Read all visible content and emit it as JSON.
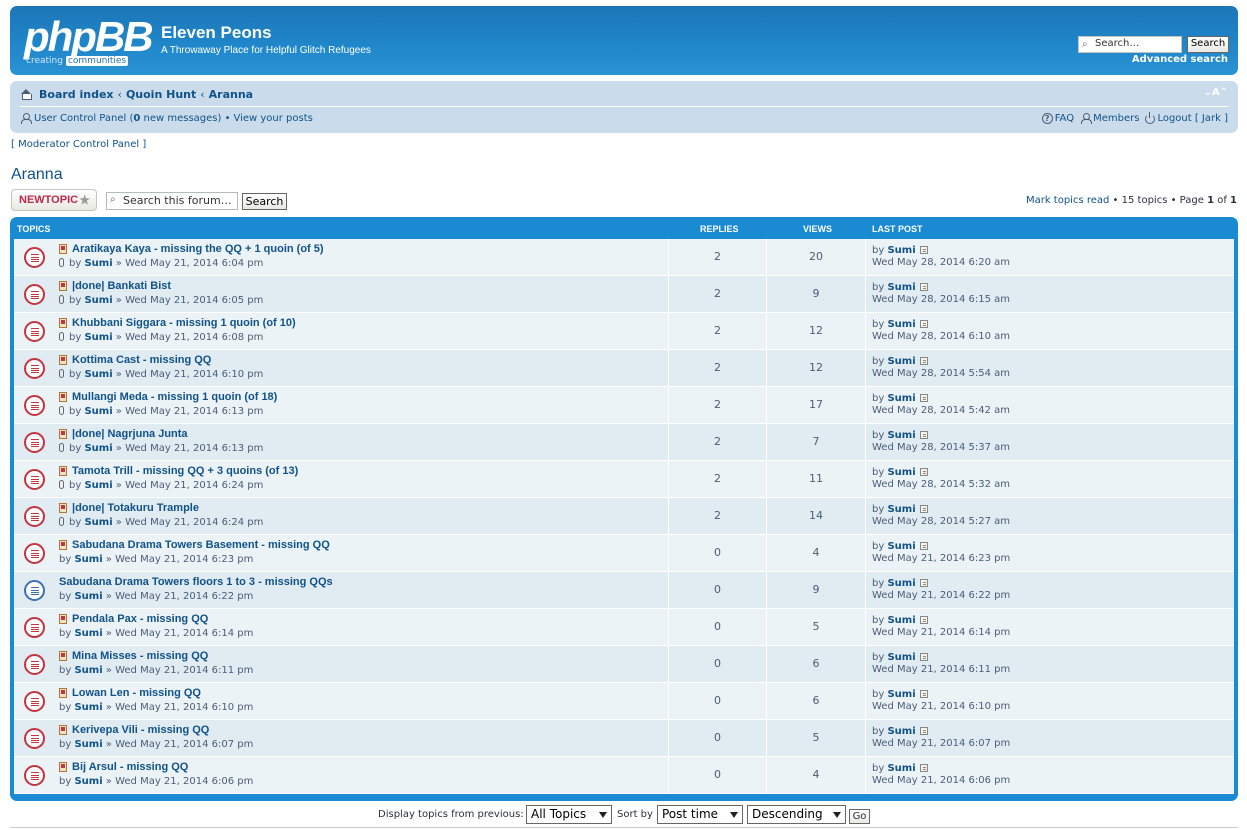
{
  "header": {
    "logo_main": "phpBB",
    "logo_tag1": "creating",
    "logo_tag2": "communities",
    "site_title": "Eleven Peons",
    "site_desc": "A Throwaway Place for Helpful Glitch Refugees",
    "search_placeholder": "Search…",
    "search_button": "Search",
    "advanced_search": "Advanced search"
  },
  "nav": {
    "breadcrumb": [
      "Board index",
      "Quoin Hunt",
      "Aranna"
    ],
    "separator": "‹",
    "fontsize": "⌄A⌃",
    "ucp_label": "User Control Panel (",
    "ucp_count": "0",
    "ucp_suffix": " new messages) • ",
    "view_posts": "View your posts",
    "faq": "FAQ",
    "members": "Members",
    "logout": "Logout [ Jark ]"
  },
  "moderator_panel": "[ Moderator Control Panel ]",
  "forum_title": "Aranna",
  "actions": {
    "new_topic": "NEWTOPIC",
    "new_topic_star": "★",
    "search_placeholder": "Search this forum…",
    "search_button": "Search",
    "mark_read": "Mark topics read",
    "topics_count": " • 15 topics • Page ",
    "page_current": "1",
    "page_of": " of ",
    "page_total": "1"
  },
  "table": {
    "headers": {
      "topics": "Topics",
      "replies": "Replies",
      "views": "Views",
      "last_post": "Last post"
    },
    "rows": [
      {
        "title": "Aratikaya Kaya - missing the QQ + 1 quoin (of 5)",
        "by": "by ",
        "author": "Sumi",
        "posted": " » Wed May 21, 2014 6:04 pm",
        "replies": "2",
        "views": "20",
        "lp_by": "by ",
        "lp_author": "Sumi",
        "lp_date": "Wed May 28, 2014 6:20 am",
        "icon": true,
        "attach": true,
        "read": false
      },
      {
        "title": "|done| Bankati Bist",
        "by": "by ",
        "author": "Sumi",
        "posted": " » Wed May 21, 2014 6:05 pm",
        "replies": "2",
        "views": "9",
        "lp_by": "by ",
        "lp_author": "Sumi",
        "lp_date": "Wed May 28, 2014 6:15 am",
        "icon": true,
        "attach": true,
        "read": false
      },
      {
        "title": "Khubbani Siggara - missing 1 quoin (of 10)",
        "by": "by ",
        "author": "Sumi",
        "posted": " » Wed May 21, 2014 6:08 pm",
        "replies": "2",
        "views": "12",
        "lp_by": "by ",
        "lp_author": "Sumi",
        "lp_date": "Wed May 28, 2014 6:10 am",
        "icon": true,
        "attach": true,
        "read": false
      },
      {
        "title": "Kottima Cast - missing QQ",
        "by": "by ",
        "author": "Sumi",
        "posted": " » Wed May 21, 2014 6:10 pm",
        "replies": "2",
        "views": "12",
        "lp_by": "by ",
        "lp_author": "Sumi",
        "lp_date": "Wed May 28, 2014 5:54 am",
        "icon": true,
        "attach": true,
        "read": false
      },
      {
        "title": "Mullangi Meda - missing 1 quoin (of 18)",
        "by": "by ",
        "author": "Sumi",
        "posted": " » Wed May 21, 2014 6:13 pm",
        "replies": "2",
        "views": "17",
        "lp_by": "by ",
        "lp_author": "Sumi",
        "lp_date": "Wed May 28, 2014 5:42 am",
        "icon": true,
        "attach": true,
        "read": false
      },
      {
        "title": "|done| Nagrjuna Junta",
        "by": "by ",
        "author": "Sumi",
        "posted": " » Wed May 21, 2014 6:13 pm",
        "replies": "2",
        "views": "7",
        "lp_by": "by ",
        "lp_author": "Sumi",
        "lp_date": "Wed May 28, 2014 5:37 am",
        "icon": true,
        "attach": true,
        "read": false
      },
      {
        "title": "Tamota Trill - missing QQ + 3 quoins (of 13)",
        "by": "by ",
        "author": "Sumi",
        "posted": " » Wed May 21, 2014 6:24 pm",
        "replies": "2",
        "views": "11",
        "lp_by": "by ",
        "lp_author": "Sumi",
        "lp_date": "Wed May 28, 2014 5:32 am",
        "icon": true,
        "attach": true,
        "read": false
      },
      {
        "title": "|done| Totakuru Trample",
        "by": "by ",
        "author": "Sumi",
        "posted": " » Wed May 21, 2014 6:24 pm",
        "replies": "2",
        "views": "14",
        "lp_by": "by ",
        "lp_author": "Sumi",
        "lp_date": "Wed May 28, 2014 5:27 am",
        "icon": true,
        "attach": true,
        "read": false
      },
      {
        "title": "Sabudana Drama Towers Basement - missing QQ",
        "by": "by ",
        "author": "Sumi",
        "posted": " » Wed May 21, 2014 6:23 pm",
        "replies": "0",
        "views": "4",
        "lp_by": "by ",
        "lp_author": "Sumi",
        "lp_date": "Wed May 21, 2014 6:23 pm",
        "icon": true,
        "attach": false,
        "read": false
      },
      {
        "title": "Sabudana Drama Towers floors 1 to 3 - missing QQs",
        "by": "by ",
        "author": "Sumi",
        "posted": " » Wed May 21, 2014 6:22 pm",
        "replies": "0",
        "views": "9",
        "lp_by": "by ",
        "lp_author": "Sumi",
        "lp_date": "Wed May 21, 2014 6:22 pm",
        "icon": false,
        "attach": false,
        "read": true
      },
      {
        "title": "Pendala Pax - missing QQ",
        "by": "by ",
        "author": "Sumi",
        "posted": " » Wed May 21, 2014 6:14 pm",
        "replies": "0",
        "views": "5",
        "lp_by": "by ",
        "lp_author": "Sumi",
        "lp_date": "Wed May 21, 2014 6:14 pm",
        "icon": true,
        "attach": false,
        "read": false
      },
      {
        "title": "Mina Misses - missing QQ",
        "by": "by ",
        "author": "Sumi",
        "posted": " » Wed May 21, 2014 6:11 pm",
        "replies": "0",
        "views": "6",
        "lp_by": "by ",
        "lp_author": "Sumi",
        "lp_date": "Wed May 21, 2014 6:11 pm",
        "icon": true,
        "attach": false,
        "read": false
      },
      {
        "title": "Lowan Len - missing QQ",
        "by": "by ",
        "author": "Sumi",
        "posted": " » Wed May 21, 2014 6:10 pm",
        "replies": "0",
        "views": "6",
        "lp_by": "by ",
        "lp_author": "Sumi",
        "lp_date": "Wed May 21, 2014 6:10 pm",
        "icon": true,
        "attach": false,
        "read": false
      },
      {
        "title": "Kerivepa Vili - missing QQ",
        "by": "by ",
        "author": "Sumi",
        "posted": " » Wed May 21, 2014 6:07 pm",
        "replies": "0",
        "views": "5",
        "lp_by": "by ",
        "lp_author": "Sumi",
        "lp_date": "Wed May 21, 2014 6:07 pm",
        "icon": true,
        "attach": false,
        "read": false
      },
      {
        "title": "Bij Arsul - missing QQ",
        "by": "by ",
        "author": "Sumi",
        "posted": " » Wed May 21, 2014 6:06 pm",
        "replies": "0",
        "views": "4",
        "lp_by": "by ",
        "lp_author": "Sumi",
        "lp_date": "Wed May 21, 2014 6:06 pm",
        "icon": true,
        "attach": false,
        "read": false
      }
    ]
  },
  "bottom": {
    "display_label": "Display topics from previous:",
    "display_value": "All Topics",
    "sort_label": "Sort by",
    "sort_value": "Post time",
    "order_value": "Descending",
    "go": "Go"
  },
  "colors": {
    "header_blue": "#1f86c9",
    "link": "#105289",
    "unread_icon": "#c4343f",
    "read_icon": "#3d6fb5",
    "row_light": "#ecf3f7",
    "row_dark": "#e1ebf2"
  }
}
